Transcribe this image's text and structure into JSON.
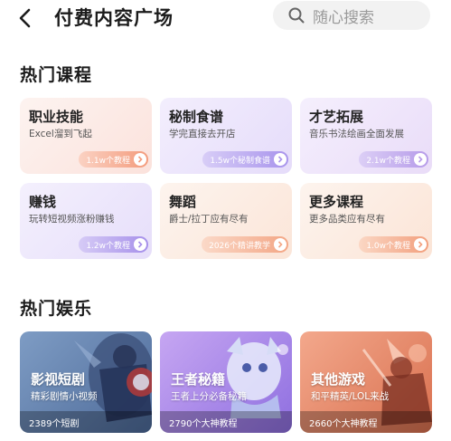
{
  "header": {
    "title": "付费内容广场",
    "search_placeholder": "随心搜索"
  },
  "courses": {
    "section_title": "热门课程",
    "items": [
      {
        "title": "职业技能",
        "subtitle": "Excel溜到飞起",
        "count": "1.1w个教程"
      },
      {
        "title": "秘制食谱",
        "subtitle": "学完直接去开店",
        "count": "1.5w个秘制食谱"
      },
      {
        "title": "才艺拓展",
        "subtitle": "音乐书法绘画全面发展",
        "count": "2.1w个教程"
      },
      {
        "title": "赚钱",
        "subtitle": "玩转短视频涨粉赚钱",
        "count": "1.2w个教程"
      },
      {
        "title": "舞蹈",
        "subtitle": "爵士/拉丁应有尽有",
        "count": "2026个精讲教学"
      },
      {
        "title": "更多课程",
        "subtitle": "更多品类应有尽有",
        "count": "1.0w个教程"
      }
    ]
  },
  "entertainment": {
    "section_title": "热门娱乐",
    "items": [
      {
        "title": "影视短剧",
        "subtitle": "精彩剧情小视频",
        "count": "2389个短剧"
      },
      {
        "title": "王者秘籍",
        "subtitle": "王者上分必备秘籍",
        "count": "2790个大神教程"
      },
      {
        "title": "其他游戏",
        "subtitle": "和平精英/LOL来战",
        "count": "2660个大神教程"
      }
    ]
  },
  "colors": {
    "card_pink": "#fbe7e3",
    "card_purple": "#ece6fb",
    "card_peach": "#fdeade",
    "pill_orange": "#f6a98c",
    "pill_purple": "#b8a6f0",
    "pill_coral": "#f3a17f"
  }
}
